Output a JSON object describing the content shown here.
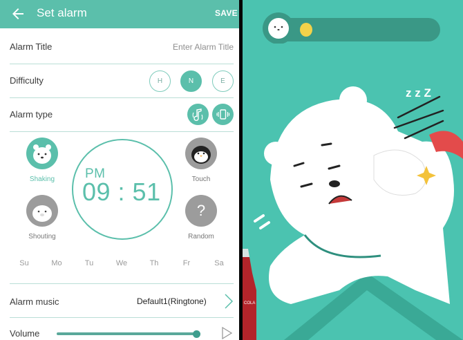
{
  "header": {
    "back_icon": "arrow-left-icon",
    "title": "Set alarm",
    "save_label": "SAVE"
  },
  "alarm_title": {
    "label": "Alarm Title",
    "placeholder": "Enter Alarm Title"
  },
  "difficulty": {
    "label": "Difficulty",
    "options": [
      "H",
      "N",
      "E"
    ],
    "selected": "N"
  },
  "alarm_type": {
    "label": "Alarm type",
    "icons": [
      "sound-vibrate-icon",
      "phone-vibrate-icon"
    ]
  },
  "characters": [
    {
      "name": "Shaking",
      "icon": "polar-bear-icon",
      "selected": true
    },
    {
      "name": "Touch",
      "icon": "penguin-icon",
      "selected": false
    },
    {
      "name": "Shouting",
      "icon": "seal-icon",
      "selected": false
    },
    {
      "name": "Random",
      "icon": "question-mark-icon",
      "glyph": "?",
      "selected": false
    }
  ],
  "clock": {
    "meridiem": "PM",
    "time": "09 : 51"
  },
  "days": [
    "Su",
    "Mo",
    "Tu",
    "We",
    "Th",
    "Fr",
    "Sa"
  ],
  "alarm_music": {
    "label": "Alarm music",
    "value": "Default1(Ringtone)"
  },
  "volume": {
    "label": "Volume",
    "level": 1.0
  },
  "colors": {
    "accent": "#5bbfab",
    "teal_bg": "#4bc3b0",
    "progress_track": "#3a9886",
    "progress_dot": "#f3d24a"
  },
  "game": {
    "progress_icon": "polar-bear-face-icon",
    "zzz_text": "z z Z",
    "cola_text": "COLA",
    "sparkle_icon": "sparkle-icon"
  }
}
